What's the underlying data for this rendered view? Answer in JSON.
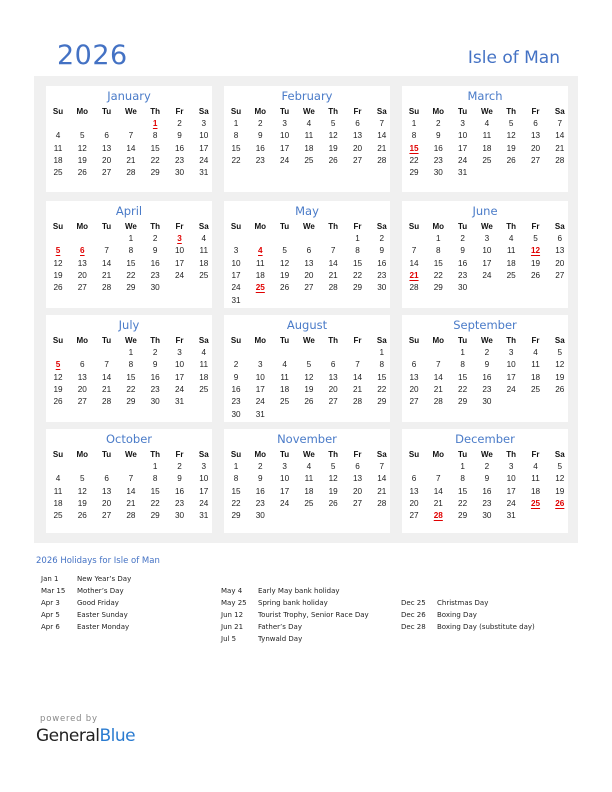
{
  "header": {
    "year": "2026",
    "country": "Isle of Man"
  },
  "weekdays": [
    "Su",
    "Mo",
    "Tu",
    "We",
    "Th",
    "Fr",
    "Sa"
  ],
  "colors": {
    "accent": "#4472c4",
    "holiday": "#e00000",
    "background": "#f0f0f0"
  },
  "months": [
    {
      "name": "January",
      "start": 4,
      "days": 31,
      "holidays": [
        1
      ]
    },
    {
      "name": "February",
      "start": 0,
      "days": 28,
      "holidays": []
    },
    {
      "name": "March",
      "start": 0,
      "days": 31,
      "holidays": [
        15
      ]
    },
    {
      "name": "April",
      "start": 3,
      "days": 30,
      "holidays": [
        3,
        5,
        6
      ]
    },
    {
      "name": "May",
      "start": 5,
      "days": 31,
      "holidays": [
        4,
        25
      ]
    },
    {
      "name": "June",
      "start": 1,
      "days": 30,
      "holidays": [
        12,
        21
      ]
    },
    {
      "name": "July",
      "start": 3,
      "days": 31,
      "holidays": [
        5
      ]
    },
    {
      "name": "August",
      "start": 6,
      "days": 31,
      "holidays": []
    },
    {
      "name": "September",
      "start": 2,
      "days": 30,
      "holidays": []
    },
    {
      "name": "October",
      "start": 4,
      "days": 31,
      "holidays": []
    },
    {
      "name": "November",
      "start": 0,
      "days": 30,
      "holidays": []
    },
    {
      "name": "December",
      "start": 2,
      "days": 31,
      "holidays": [
        25,
        26,
        28
      ]
    }
  ],
  "holidays_title": "2026 Holidays for Isle of Man",
  "holiday_columns": [
    [
      {
        "date": "Jan 1",
        "name": "New Year’s Day"
      },
      {
        "date": "Mar 15",
        "name": "Mother’s Day"
      },
      {
        "date": "Apr 3",
        "name": "Good Friday"
      },
      {
        "date": "Apr 5",
        "name": "Easter Sunday"
      },
      {
        "date": "Apr 6",
        "name": "Easter Monday"
      }
    ],
    [
      {
        "date": "May 4",
        "name": "Early May bank holiday"
      },
      {
        "date": "May 25",
        "name": "Spring bank holiday"
      },
      {
        "date": "Jun 12",
        "name": "Tourist Trophy, Senior Race Day"
      },
      {
        "date": "Jun 21",
        "name": "Father’s Day"
      },
      {
        "date": "Jul 5",
        "name": "Tynwald Day"
      }
    ],
    [
      {
        "date": "Dec 25",
        "name": "Christmas Day"
      },
      {
        "date": "Dec 26",
        "name": "Boxing Day"
      },
      {
        "date": "Dec 28",
        "name": "Boxing Day (substitute day)"
      }
    ]
  ],
  "footer": {
    "powered_by": "powered by",
    "brand_general": "General",
    "brand_blue": "Blue"
  }
}
